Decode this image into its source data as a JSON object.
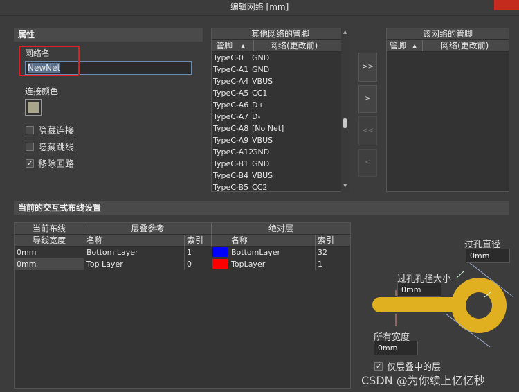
{
  "window": {
    "title": "编辑网络 [mm]"
  },
  "properties": {
    "header": "属性",
    "net_name_label": "网络名",
    "net_name_value": "NewNet",
    "connect_color_label": "连接颜色",
    "connect_color": "#a8a58a",
    "checkboxes": [
      {
        "label": "隐藏连接",
        "checked": false
      },
      {
        "label": "隐藏跳线",
        "checked": false
      },
      {
        "label": "移除回路",
        "checked": true
      }
    ]
  },
  "other_pins": {
    "title": "其他网络的管脚",
    "col_pin": "管脚",
    "col_net": "网络(更改前)",
    "rows": [
      {
        "pin": "TypeC-0",
        "net": "GND"
      },
      {
        "pin": "TypeC-A1",
        "net": "GND"
      },
      {
        "pin": "TypeC-A4",
        "net": "VBUS"
      },
      {
        "pin": "TypeC-A5",
        "net": "CC1"
      },
      {
        "pin": "TypeC-A6",
        "net": "D+"
      },
      {
        "pin": "TypeC-A7",
        "net": "D-"
      },
      {
        "pin": "TypeC-A8",
        "net": "[No Net]"
      },
      {
        "pin": "TypeC-A9",
        "net": "VBUS"
      },
      {
        "pin": "TypeC-A12",
        "net": "GND"
      },
      {
        "pin": "TypeC-B1",
        "net": "GND"
      },
      {
        "pin": "TypeC-B4",
        "net": "VBUS"
      },
      {
        "pin": "TypeC-B5",
        "net": "CC2"
      }
    ]
  },
  "this_pins": {
    "title": "该网络的管脚",
    "col_pin": "管脚",
    "col_net": "网络(更改前)"
  },
  "transfer_buttons": {
    "add_all": ">>",
    "add": ">",
    "remove_all": "<<",
    "remove": "<"
  },
  "routing": {
    "header": "当前的交互式布线设置",
    "group_current": "当前布线",
    "group_stack": "层叠参考",
    "group_abs": "绝对层",
    "col_width": "导线宽度",
    "col_name": "名称",
    "col_index": "索引",
    "col_abs_name": "名称",
    "col_abs_index": "索引",
    "rows": [
      {
        "width": "0mm",
        "name": "Bottom Layer",
        "index": "1",
        "abs_color": "#0000ff",
        "abs_name": "BottomLayer",
        "abs_index": "32"
      },
      {
        "width": "0mm",
        "name": "Top Layer",
        "index": "0",
        "abs_color": "#ff0000",
        "abs_name": "TopLayer",
        "abs_index": "1"
      }
    ]
  },
  "via_diagram": {
    "via_diameter_label": "过孔直径",
    "via_diameter_value": "0mm",
    "hole_size_label": "过孔孔径大小",
    "hole_size_value": "0mm",
    "width_label": "所有宽度",
    "width_value": "0mm",
    "layers_only_label": "仅层叠中的层",
    "layers_only_checked": true,
    "trace_color": "#e0b020"
  },
  "watermark": "CSDN @为你续上亿亿秒"
}
